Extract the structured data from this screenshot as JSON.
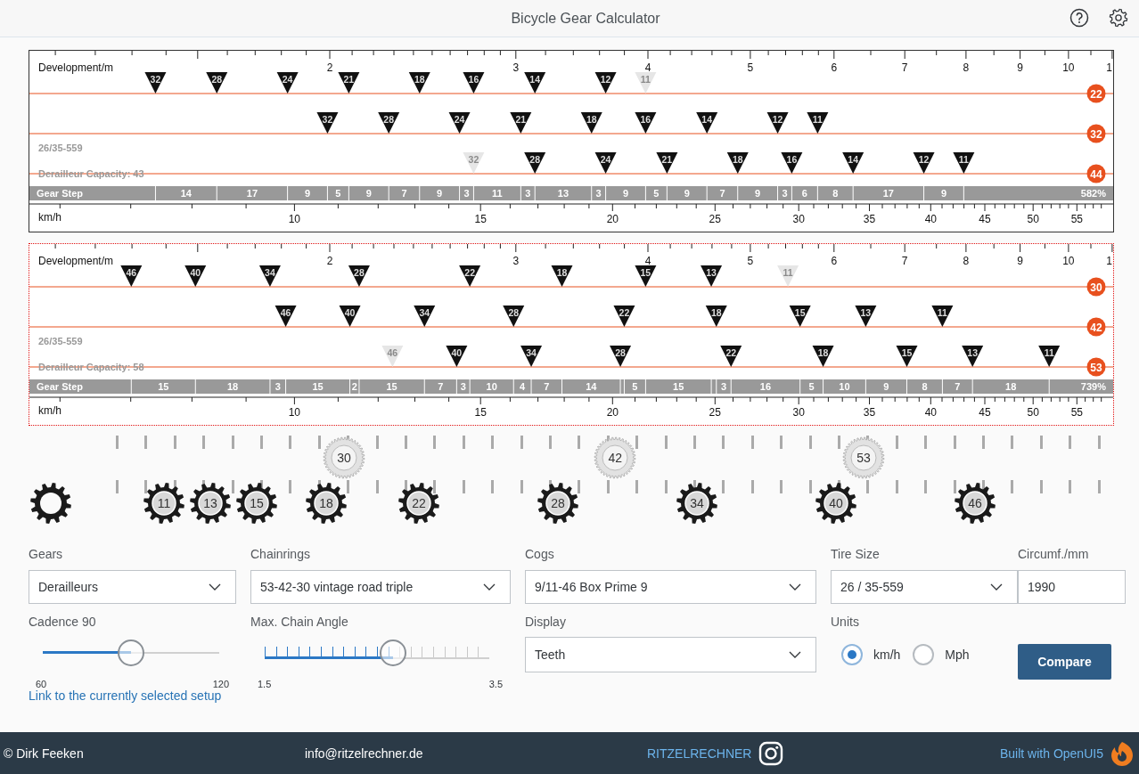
{
  "header": {
    "title": "Bicycle Gear Calculator"
  },
  "charts": [
    {
      "selected": false,
      "development_label": "Development/m",
      "development_ticks": [
        {
          "label": "2",
          "clipped": false
        },
        {
          "label": "3",
          "clipped": false
        },
        {
          "label": "4",
          "clipped": false
        },
        {
          "label": "5",
          "clipped": false
        },
        {
          "label": "6",
          "clipped": false
        },
        {
          "label": "7",
          "clipped": false
        },
        {
          "label": "8",
          "clipped": false
        },
        {
          "label": "9",
          "clipped": false
        },
        {
          "label": "10",
          "clipped": false
        },
        {
          "label": "1",
          "clipped": true
        }
      ],
      "chainrings": [
        {
          "teeth": "22",
          "cogs": [
            {
              "teeth": "32",
              "faded": false
            },
            {
              "teeth": "28",
              "faded": false
            },
            {
              "teeth": "24",
              "faded": false
            },
            {
              "teeth": "21",
              "faded": false
            },
            {
              "teeth": "18",
              "faded": false
            },
            {
              "teeth": "16",
              "faded": false
            },
            {
              "teeth": "14",
              "faded": false
            },
            {
              "teeth": "12",
              "faded": false
            },
            {
              "teeth": "11",
              "faded": true
            }
          ]
        },
        {
          "teeth": "32",
          "cogs": [
            {
              "teeth": "32",
              "faded": false
            },
            {
              "teeth": "28",
              "faded": false
            },
            {
              "teeth": "24",
              "faded": false
            },
            {
              "teeth": "21",
              "faded": false
            },
            {
              "teeth": "18",
              "faded": false
            },
            {
              "teeth": "16",
              "faded": false
            },
            {
              "teeth": "14",
              "faded": false
            },
            {
              "teeth": "12",
              "faded": false
            },
            {
              "teeth": "11",
              "faded": false
            }
          ]
        },
        {
          "teeth": "44",
          "cogs": [
            {
              "teeth": "32",
              "faded": true
            },
            {
              "teeth": "28",
              "faded": false
            },
            {
              "teeth": "24",
              "faded": false
            },
            {
              "teeth": "21",
              "faded": false
            },
            {
              "teeth": "18",
              "faded": false
            },
            {
              "teeth": "16",
              "faded": false
            },
            {
              "teeth": "14",
              "faded": false
            },
            {
              "teeth": "12",
              "faded": false
            },
            {
              "teeth": "11",
              "faded": false
            }
          ]
        }
      ],
      "tire": "26/35-559",
      "capacity": "Derailleur Capacity: 43",
      "gear_step_label": "Gear Step",
      "gear_steps": [
        "14",
        "17",
        "9",
        "5",
        "9",
        "7",
        "9",
        "3",
        "11",
        "3",
        "13",
        "3",
        "9",
        "5",
        "9",
        "7",
        "9",
        "3",
        "6",
        "8",
        "17",
        "9"
      ],
      "range": "582%",
      "speed_label": "km/h",
      "speed_ticks": [
        "10",
        "15",
        "20",
        "25",
        "30",
        "35",
        "40",
        "45",
        "50",
        "55"
      ]
    },
    {
      "selected": true,
      "development_label": "Development/m",
      "development_ticks": [
        {
          "label": "2",
          "clipped": false
        },
        {
          "label": "3",
          "clipped": false
        },
        {
          "label": "4",
          "clipped": false
        },
        {
          "label": "5",
          "clipped": false
        },
        {
          "label": "6",
          "clipped": false
        },
        {
          "label": "7",
          "clipped": false
        },
        {
          "label": "8",
          "clipped": false
        },
        {
          "label": "9",
          "clipped": false
        },
        {
          "label": "10",
          "clipped": false
        },
        {
          "label": "1",
          "clipped": true
        }
      ],
      "chainrings": [
        {
          "teeth": "30",
          "cogs": [
            {
              "teeth": "46",
              "faded": false
            },
            {
              "teeth": "40",
              "faded": false
            },
            {
              "teeth": "34",
              "faded": false
            },
            {
              "teeth": "28",
              "faded": false
            },
            {
              "teeth": "22",
              "faded": false
            },
            {
              "teeth": "18",
              "faded": false
            },
            {
              "teeth": "15",
              "faded": false
            },
            {
              "teeth": "13",
              "faded": false
            },
            {
              "teeth": "11",
              "faded": true
            }
          ]
        },
        {
          "teeth": "42",
          "cogs": [
            {
              "teeth": "46",
              "faded": false
            },
            {
              "teeth": "40",
              "faded": false
            },
            {
              "teeth": "34",
              "faded": false
            },
            {
              "teeth": "28",
              "faded": false
            },
            {
              "teeth": "22",
              "faded": false
            },
            {
              "teeth": "18",
              "faded": false
            },
            {
              "teeth": "15",
              "faded": false
            },
            {
              "teeth": "13",
              "faded": false
            },
            {
              "teeth": "11",
              "faded": false
            }
          ]
        },
        {
          "teeth": "53",
          "cogs": [
            {
              "teeth": "46",
              "faded": true
            },
            {
              "teeth": "40",
              "faded": false
            },
            {
              "teeth": "34",
              "faded": false
            },
            {
              "teeth": "28",
              "faded": false
            },
            {
              "teeth": "22",
              "faded": false
            },
            {
              "teeth": "18",
              "faded": false
            },
            {
              "teeth": "15",
              "faded": false
            },
            {
              "teeth": "13",
              "faded": false
            },
            {
              "teeth": "11",
              "faded": false
            }
          ]
        }
      ],
      "tire": "26/35-559",
      "capacity": "Derailleur Capacity: 58",
      "gear_step_label": "Gear Step",
      "gear_steps": [
        "15",
        "18",
        "3",
        "15",
        "2",
        "15",
        "7",
        "3",
        "10",
        "4",
        "7",
        "14",
        "5",
        "15",
        "3",
        "16",
        "5",
        "10",
        "9",
        "8",
        "7",
        "18"
      ],
      "range": "739%",
      "speed_label": "km/h",
      "speed_ticks": [
        "10",
        "15",
        "20",
        "25",
        "30",
        "35",
        "40",
        "45",
        "50",
        "55"
      ]
    }
  ],
  "gear_display": {
    "chainrings": [
      "30",
      "42",
      "53"
    ],
    "cogs": [
      "11",
      "13",
      "15",
      "18",
      "22",
      "28",
      "34",
      "40",
      "46"
    ]
  },
  "controls": {
    "gears": {
      "label": "Gears",
      "value": "Derailleurs"
    },
    "chainrings": {
      "label": "Chainrings",
      "value": "53-42-30 vintage road triple"
    },
    "cogs": {
      "label": "Cogs",
      "value": "9/11-46 Box Prime 9"
    },
    "tire_size": {
      "label": "Tire Size",
      "value": "26 / 35-559"
    },
    "circumference": {
      "label": "Circumf./mm",
      "value": "1990"
    },
    "cadence": {
      "label": "Cadence 90",
      "min": "60",
      "max": "120",
      "level": 0.5
    },
    "chain_angle": {
      "label": "Max. Chain Angle",
      "min": "1.5",
      "max": "3.5",
      "level": 0.57
    },
    "display": {
      "label": "Display",
      "value": "Teeth"
    },
    "units": {
      "label": "Units",
      "options": [
        {
          "label": "km/h",
          "selected": true
        },
        {
          "label": "Mph",
          "selected": false
        }
      ]
    },
    "compare_button": "Compare",
    "link": "Link to the currently selected setup"
  },
  "footer": {
    "author": "© Dirk Feeken",
    "email": "info@ritzelrechner.de",
    "brand": "RITZELRECHNER",
    "built_with": "Built with OpenUI5"
  }
}
